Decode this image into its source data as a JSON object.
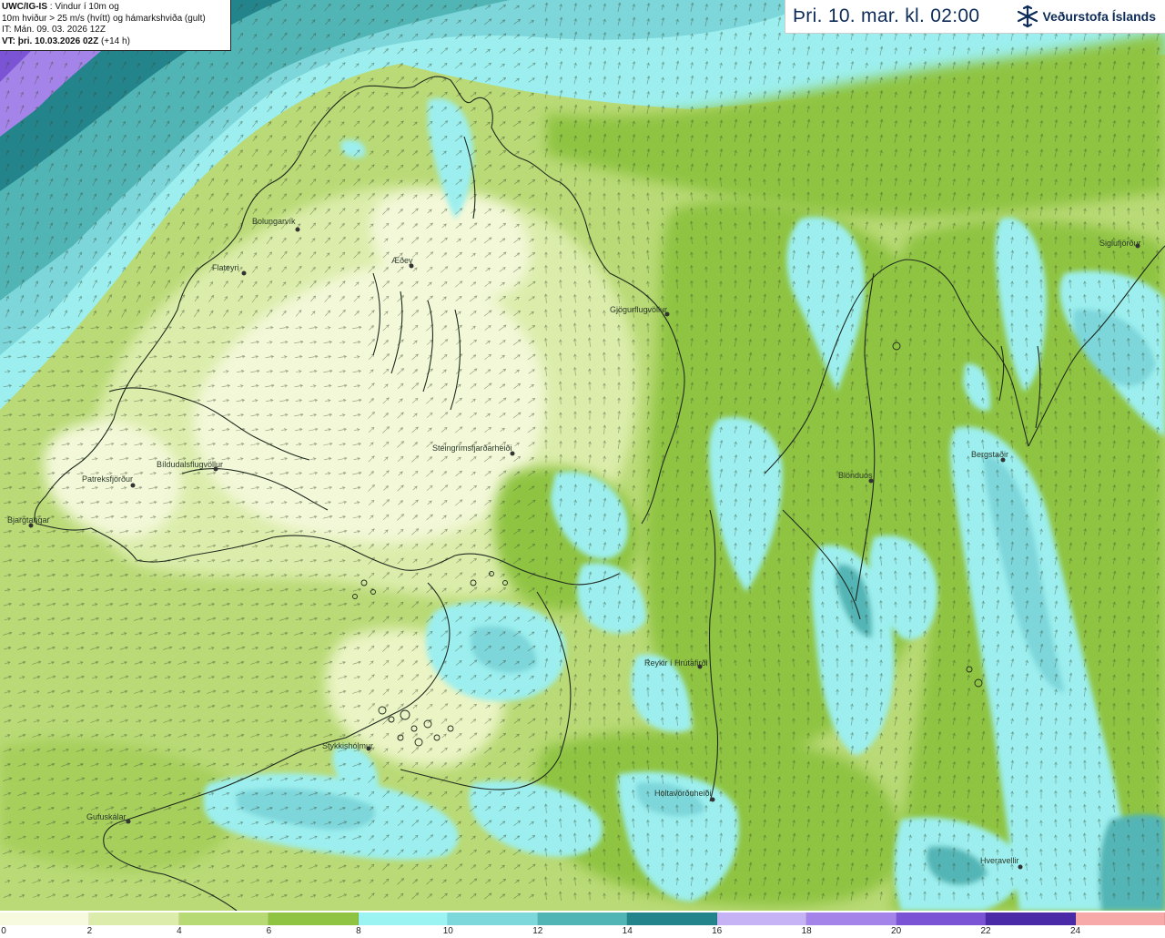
{
  "info": {
    "model": "UWC/IG-IS",
    "line1_rest": " : Vindur í 10m og",
    "line2": "10m hviður > 25 m/s (hvítt) og hámarkshviða (gult)",
    "line3": "IT: Mán. 09. 03. 2026 12Z",
    "line4_bold": "VT: þri. 10.03.2026 02Z",
    "line4_rest": " (+14 h)"
  },
  "header": {
    "valid_time": "Þri. 10. mar. kl. 02:00",
    "logo_text": "Veðurstofa Íslands",
    "logo_icon": "snowflake-arrow-logo-icon"
  },
  "legend": {
    "ticks": [
      "0",
      "2",
      "4",
      "6",
      "8",
      "10",
      "12",
      "14",
      "16",
      "18",
      "20",
      "22",
      "24"
    ],
    "colors": [
      "#f7fadf",
      "#dcedab",
      "#b8da74",
      "#8fc443",
      "#9bf3f2",
      "#7dd8dc",
      "#52b5b5",
      "#23858b",
      "#c6b3f5",
      "#a584ea",
      "#7b54d6",
      "#4a2aa6",
      "#f7a8a8"
    ]
  },
  "stations": [
    {
      "name": "Bolungarvík"
    },
    {
      "name": "Flateyri"
    },
    {
      "name": "Æðey"
    },
    {
      "name": "Patreksfjörður"
    },
    {
      "name": "Bíldudalsflugvöllur"
    },
    {
      "name": "Bjargtangar"
    },
    {
      "name": "Steingrímsfjarðarheiði"
    },
    {
      "name": "Gjögurflugvöllur"
    },
    {
      "name": "Blönduós"
    },
    {
      "name": "Bergstaðir"
    },
    {
      "name": "Siglufjörður"
    },
    {
      "name": "Reykir í Hrútafirði"
    },
    {
      "name": "Stykkishólmur"
    },
    {
      "name": "Holtavörðuheiði"
    },
    {
      "name": "Gufuskálar"
    },
    {
      "name": "Hveravellir"
    }
  ]
}
